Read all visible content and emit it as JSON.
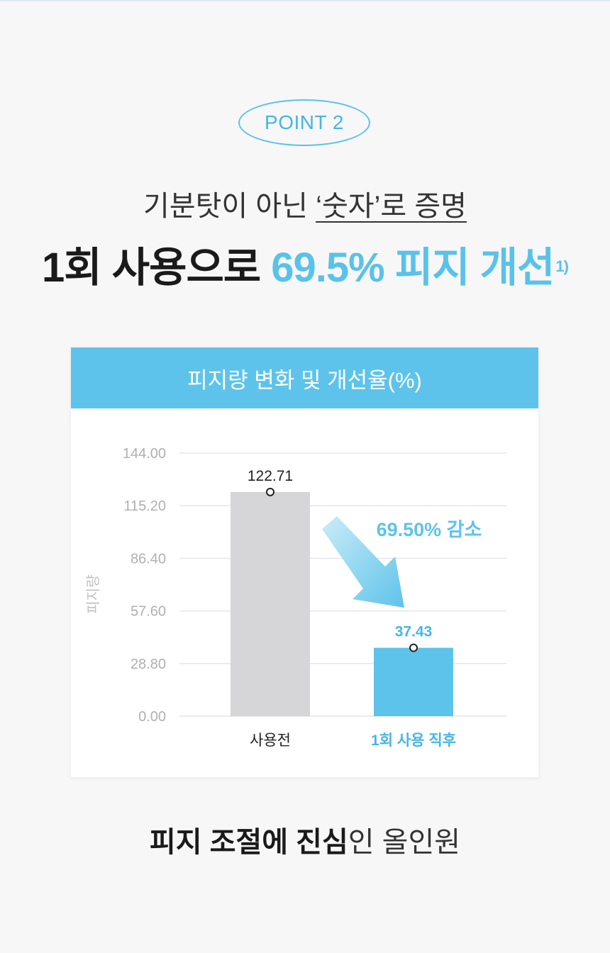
{
  "badge": "POINT 2",
  "subhead": {
    "pre": "기분탓이 아닌 ",
    "underlined": "‘숫자’로 증명"
  },
  "headline": {
    "pre": "1회 사용으로 ",
    "accent": "69.5% 피지 개선",
    "footnote": "1)"
  },
  "chart_header": "피지량 변화 및 개선율(%)",
  "chart_data": {
    "type": "bar",
    "categories": [
      "사용전",
      "1회 사용 직후"
    ],
    "values": [
      122.71,
      37.43
    ],
    "value_labels": [
      "122.71",
      "37.43"
    ],
    "ylabel": "피지량",
    "ylim": [
      0,
      144
    ],
    "yticks": [
      "0.00",
      "28.80",
      "57.60",
      "86.40",
      "115.20",
      "144.00"
    ],
    "annotation": "69.50% 감소",
    "colors": {
      "before": "#d6d5d7",
      "after": "#5ec3ea",
      "grid": "#e6e6e6",
      "tick": "#b0b0b0"
    },
    "grid": true
  },
  "footer": {
    "bold": "피지 조절에 진심",
    "light": "인 올인원"
  }
}
